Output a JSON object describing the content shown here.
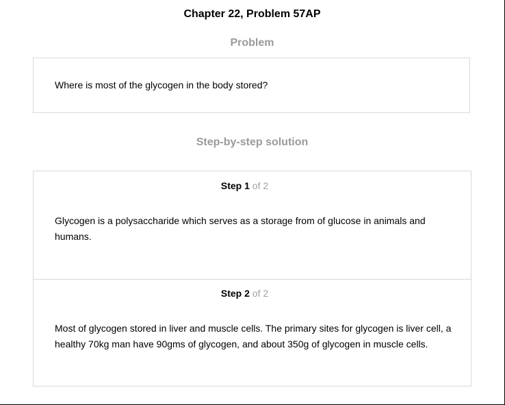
{
  "page": {
    "title": "Chapter 22, Problem 57AP"
  },
  "problem": {
    "heading": "Problem",
    "text": "Where is most of the glycogen in the body stored?"
  },
  "solution": {
    "heading": "Step-by-step solution",
    "steps": [
      {
        "label": "Step",
        "number": "1",
        "of_text": "of 2",
        "text": "Glycogen is a polysaccharide which serves as a storage from of glucose in animals and humans."
      },
      {
        "label": "Step",
        "number": "2",
        "of_text": "of 2",
        "text": "Most of glycogen stored in liver and muscle cells. The primary sites for glycogen is liver cell, a healthy 70kg man have 90gms of glycogen, and about 350g of glycogen in muscle cells."
      }
    ]
  }
}
